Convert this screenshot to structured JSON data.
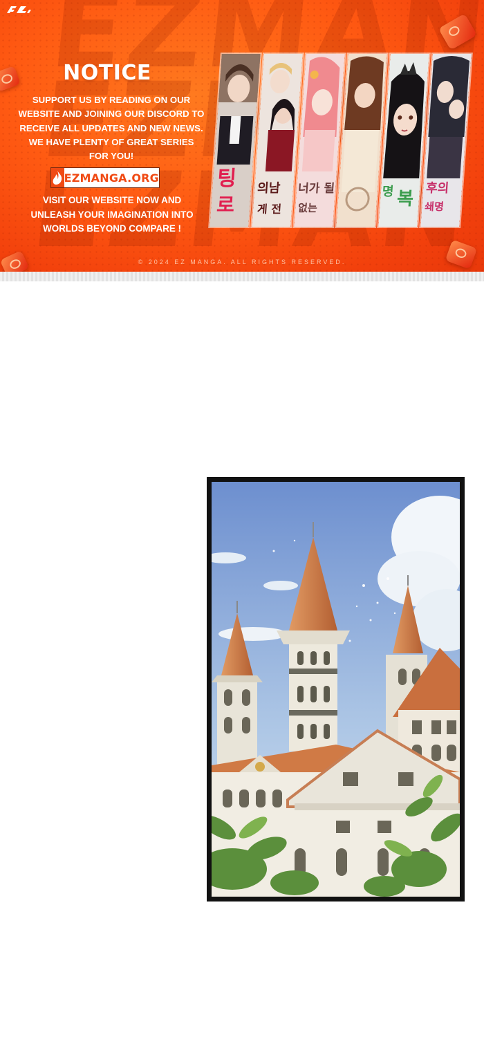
{
  "banner": {
    "title": "NOTICE",
    "body_lines": [
      "SUPPORT US BY READING ON OUR",
      "WEBSITE AND JOINING OUR DISCORD TO",
      "RECEIVE ALL UPDATES AND NEW NEWS.",
      "WE HAVE PLENTY OF GREAT SERIES",
      "FOR YOU!"
    ],
    "site_label": "EZMANGA.ORG",
    "cta_lines": [
      "VISIT OUR WEBSITE NOW AND",
      "UNLEASH YOUR IMAGINATION INTO",
      "WORLDS BEYOND COMPARE !"
    ],
    "copyright": "© 2024 EZ MANGA. ALL RIGHTS RESERVED.",
    "background_watermark": "EZMAN\nEZMAN\nEZMAN",
    "colors": {
      "orange": "#ff5a12",
      "deep_orange": "#e8380a",
      "white": "#ffffff"
    }
  },
  "comic": {
    "scene": "castle-illustration",
    "colors": {
      "sky_top": "#6d8fcf",
      "sky_bottom": "#d5e6f3",
      "roof": "#c8743f",
      "wall": "#ece8dc",
      "foliage": "#5b8f3c",
      "frame": "#111111"
    }
  }
}
